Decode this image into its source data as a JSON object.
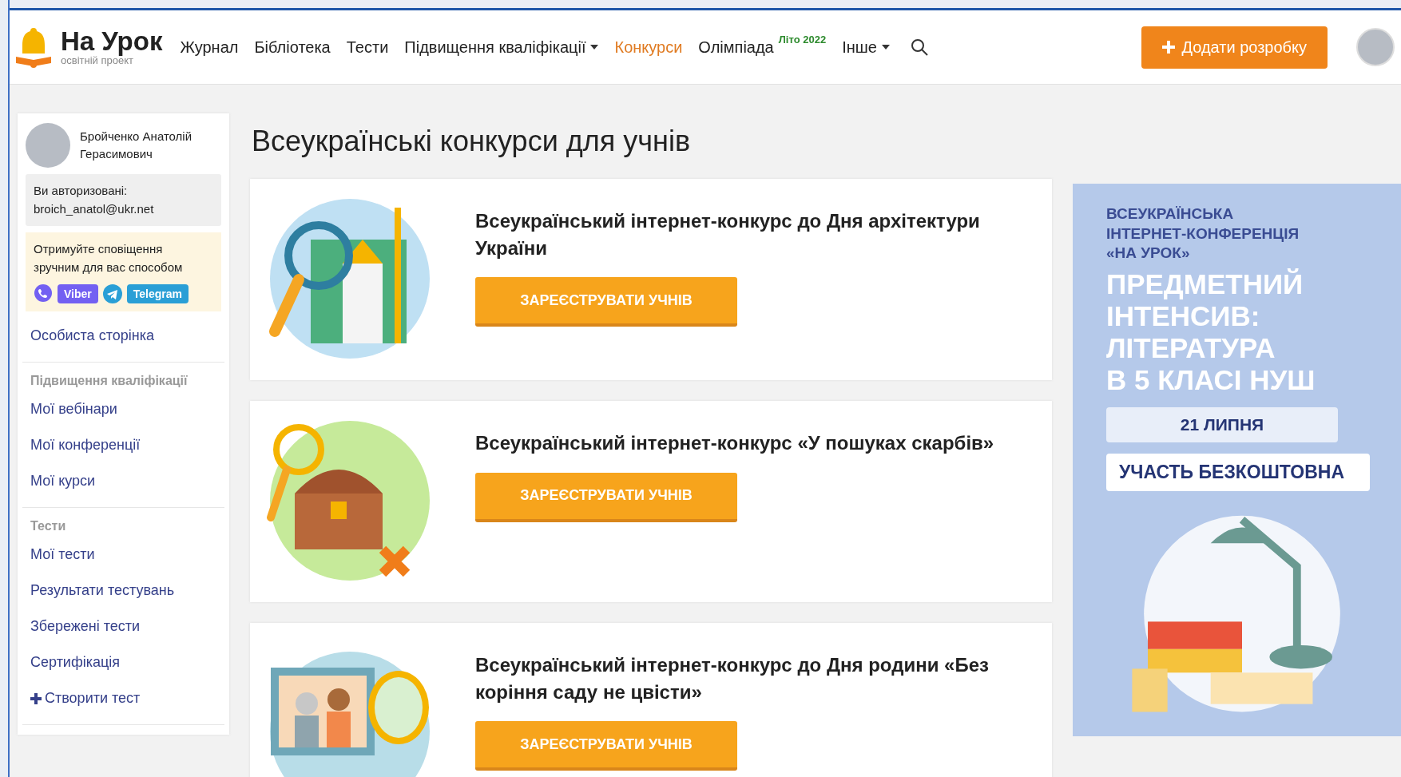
{
  "header": {
    "logo": {
      "title": "На Урок",
      "subtitle": "освітній проект"
    },
    "nav": [
      {
        "label": "Журнал",
        "selected": false,
        "dropdown": false
      },
      {
        "label": "Бібліотека",
        "selected": false,
        "dropdown": false
      },
      {
        "label": "Тести",
        "selected": false,
        "dropdown": false
      },
      {
        "label": "Підвищення кваліфікації",
        "selected": false,
        "dropdown": true
      },
      {
        "label": "Конкурси",
        "selected": true,
        "dropdown": false
      },
      {
        "label": "Олімпіада",
        "selected": false,
        "dropdown": false,
        "badge": "Літо 2022"
      },
      {
        "label": "Інше",
        "selected": false,
        "dropdown": true
      }
    ],
    "add_button": "Додати розробку"
  },
  "sidebar": {
    "user_name": "Бройченко Анатолій Герасимович",
    "auth": {
      "label": "Ви авторизовані:",
      "email": "broich_anatol@ukr.net"
    },
    "notify": {
      "text": "Отримуйте сповіщення зручним для вас способом",
      "buttons": [
        {
          "kind": "viber",
          "label": "Viber"
        },
        {
          "kind": "telegram",
          "label": "Telegram"
        }
      ]
    },
    "sections": [
      {
        "links": [
          {
            "kind": "link",
            "label": "Особиста сторінка"
          }
        ]
      },
      {
        "heading": "Підвищення кваліфікації",
        "links": [
          {
            "kind": "link",
            "label": "Мої вебінари"
          },
          {
            "kind": "link",
            "label": "Мої конференції"
          },
          {
            "kind": "link",
            "label": "Мої курси"
          }
        ]
      },
      {
        "heading": "Тести",
        "links": [
          {
            "kind": "link",
            "label": "Мої тести"
          },
          {
            "kind": "link",
            "label": "Результати тестувань"
          },
          {
            "kind": "link",
            "label": "Збережені тести"
          },
          {
            "kind": "link",
            "label": "Сертифікація"
          },
          {
            "kind": "create",
            "label": "Створити тест"
          }
        ]
      }
    ]
  },
  "main": {
    "title": "Всеукраїнські конкурси для учнів",
    "contests": [
      {
        "kind": "architecture",
        "title": "Всеукраїнський інтернет-конкурс до Дня архітектури України",
        "button": "ЗАРЕЄСТРУВАТИ УЧНІВ"
      },
      {
        "kind": "treasure",
        "title": "Всеукраїнський інтернет-конкурс «У пошуках скарбів»",
        "button": "ЗАРЕЄСТРУВАТИ УЧНІВ"
      },
      {
        "kind": "family",
        "title": "Всеукраїнський інтернет-конкурс до Дня родини «Без коріння саду не цвісти»",
        "button": "ЗАРЕЄСТРУВАТИ УЧНІВ"
      }
    ]
  },
  "banner": {
    "kicker": "ВСЕУКРАЇНСЬКА ІНТЕРНЕТ-КОНФЕРЕНЦІЯ «НА УРОК»",
    "headline": [
      "ПРЕДМЕТНИЙ",
      "ІНТЕНСИВ:",
      "ЛІТЕРАТУРА",
      "В 5 КЛАСІ НУШ"
    ],
    "date": "21 ЛИПНЯ",
    "note": "УЧАСТЬ БЕЗКОШТОВНА"
  }
}
